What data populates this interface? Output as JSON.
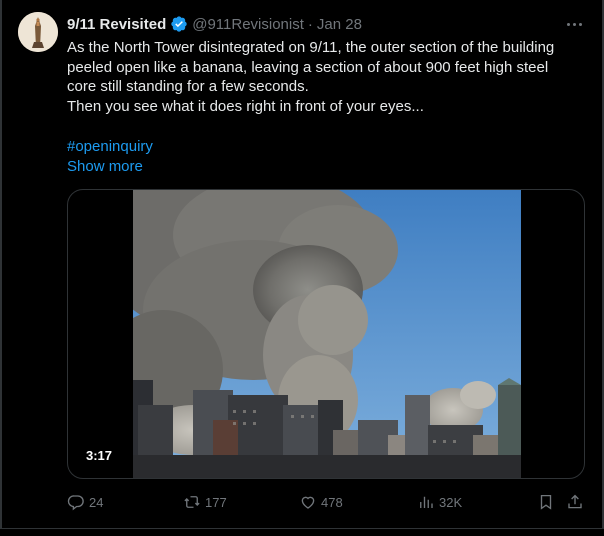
{
  "tweet": {
    "author_name": "9/11 Revisited",
    "handle": "@911Revisionist",
    "separator": "·",
    "date": "Jan 28",
    "text_lines": [
      "As the North Tower disintegrated on 9/11, the outer section of the building peeled open like a banana, leaving a section of about 900 feet high steel core still standing for a few seconds.",
      "Then you see what it does right in front of your eyes..."
    ],
    "hashtag": "#openinquiry",
    "show_more": "Show more",
    "video_duration": "3:17"
  },
  "actions": {
    "replies": "24",
    "reposts": "177",
    "likes": "478",
    "views": "32K"
  },
  "icons": {
    "verified": "verified-badge-icon",
    "more": "more-dots-icon",
    "reply": "reply-icon",
    "repost": "repost-icon",
    "like": "heart-icon",
    "views": "views-chart-icon",
    "bookmark": "bookmark-icon",
    "share": "share-icon"
  },
  "colors": {
    "background": "#000000",
    "text": "#e7e9ea",
    "muted": "#71767b",
    "accent": "#1d9bf0",
    "border": "#2f3336"
  }
}
